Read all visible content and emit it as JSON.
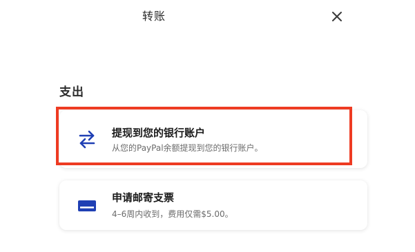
{
  "header": {
    "title": "转账",
    "close_icon": "close-icon"
  },
  "section": {
    "title": "支出"
  },
  "options": [
    {
      "title": "提现到您的银行账户",
      "subtitle": "从您的PayPal余额提现到您的银行账户。",
      "icon": "transfer-arrows-icon",
      "highlighted": true
    },
    {
      "title": "申请邮寄支票",
      "subtitle": "4–6周内收到，费用仅需$5.00。",
      "icon": "check-card-icon",
      "highlighted": false
    }
  ],
  "colors": {
    "accent_blue": "#1f3fb4",
    "highlight_red": "#ee3b22",
    "text_primary": "#1a1a1a",
    "text_secondary": "#6b6b6b"
  }
}
